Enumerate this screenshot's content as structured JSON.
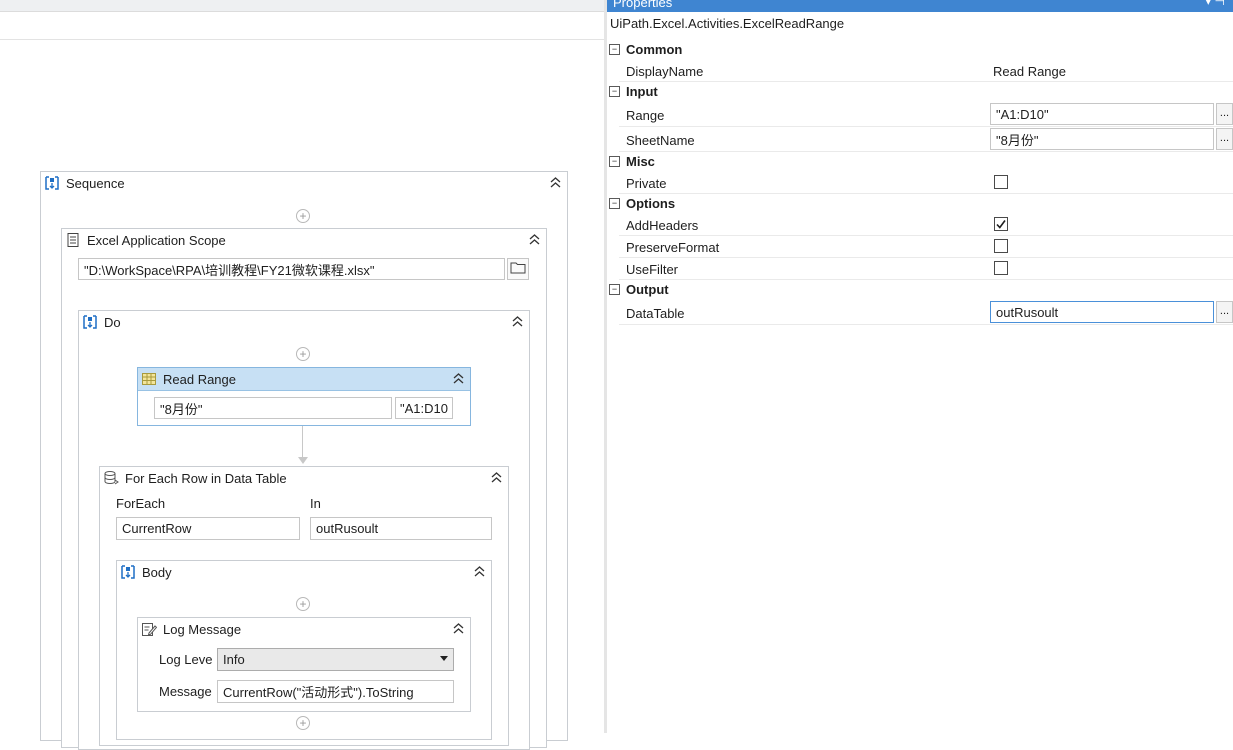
{
  "designer": {
    "sequence": {
      "title": "Sequence"
    },
    "excel_scope": {
      "title": "Excel Application Scope",
      "workbook_path": "\"D:\\WorkSpace\\RPA\\培训教程\\FY21微软课程.xlsx\""
    },
    "do_block": {
      "title": "Do"
    },
    "read_range": {
      "title": "Read Range",
      "sheet_value": "\"8月份\"",
      "range_value": "\"A1:D10"
    },
    "for_each_row": {
      "title": "For Each Row in Data Table",
      "foreach_label": "ForEach",
      "foreach_value": "CurrentRow",
      "in_label": "In",
      "in_value": "outRusoult"
    },
    "body": {
      "title": "Body"
    },
    "log_message": {
      "title": "Log Message",
      "level_label": "Log Leve",
      "level_value": "Info",
      "message_label": "Message",
      "message_value": "CurrentRow(\"活动形式\").ToString"
    }
  },
  "properties": {
    "panel_title": "Properties",
    "activity_type": "UiPath.Excel.Activities.ExcelReadRange",
    "categories": {
      "common": "Common",
      "input": "Input",
      "misc": "Misc",
      "options": "Options",
      "output": "Output"
    },
    "rows": {
      "display_name": {
        "name": "DisplayName",
        "value": "Read Range"
      },
      "range": {
        "name": "Range",
        "value": "\"A1:D10\""
      },
      "sheet_name": {
        "name": "SheetName",
        "value": "\"8月份\""
      },
      "private": {
        "name": "Private",
        "checked": false
      },
      "add_headers": {
        "name": "AddHeaders",
        "checked": true
      },
      "preserve_format": {
        "name": "PreserveFormat",
        "checked": false
      },
      "use_filter": {
        "name": "UseFilter",
        "checked": false
      },
      "data_table": {
        "name": "DataTable",
        "value": "outRusoult"
      }
    },
    "ellipsis": "...",
    "collapse_glyph": "⊟"
  },
  "colors": {
    "selected_header": "#c7e0f4",
    "panel_title_bar": "#3f85d1",
    "connector": "#c8c8c8"
  },
  "icons": {
    "sequence": "sequence-icon",
    "excel_scope": "excel-scope-icon",
    "read_range": "read-range-icon",
    "for_each": "for-each-row-icon",
    "log": "log-message-icon",
    "folder": "folder-icon",
    "collapse": "double-chevron-up-icon",
    "add": "add-activity-icon"
  }
}
